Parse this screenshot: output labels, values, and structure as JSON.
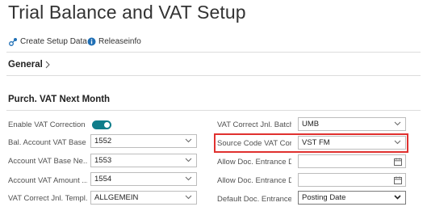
{
  "page": {
    "title": "Trial Balance and VAT Setup"
  },
  "actions": {
    "create_setup": "Create Setup Data",
    "release_info": "Releaseinfo"
  },
  "sections": {
    "general": "General",
    "purch": "Purch. VAT Next Month"
  },
  "fields_left": {
    "enable_vat_label": "Enable VAT Correction",
    "enable_vat_value": true,
    "bal_account_label": "Bal. Account VAT Base",
    "bal_account_value": "1552",
    "account_vat_base_label": "Account VAT Base Ne...",
    "account_vat_base_value": "1553",
    "account_vat_amount_label": "Account VAT Amount ...",
    "account_vat_amount_value": "1554",
    "jnl_template_label": "VAT Correct Jnl. Templ...",
    "jnl_template_value": "ALLGEMEIN"
  },
  "fields_right": {
    "jnl_batch_label": "VAT Correct Jnl. Batch...",
    "jnl_batch_value": "UMB",
    "source_code_label": "Source Code VAT Corr...",
    "source_code_value": "VST FM",
    "allow_entrance_1_label": "Allow Doc. Entrance D...",
    "allow_entrance_1_value": "",
    "allow_entrance_2_label": "Allow Doc. Entrance D...",
    "allow_entrance_2_value": "",
    "default_entrance_label": "Default Doc. Entrance...",
    "default_entrance_value": "Posting Date"
  },
  "colors": {
    "toggle_on": "#0f7d8a",
    "highlight_border": "#e0312f",
    "icon_blue": "#1f6fb5"
  },
  "icons": {
    "create_setup": "create-setup-icon",
    "release_info": "info-icon",
    "general_chevron": "chevron-right-icon",
    "dropdown": "chevron-down-icon",
    "date": "calendar-icon"
  }
}
